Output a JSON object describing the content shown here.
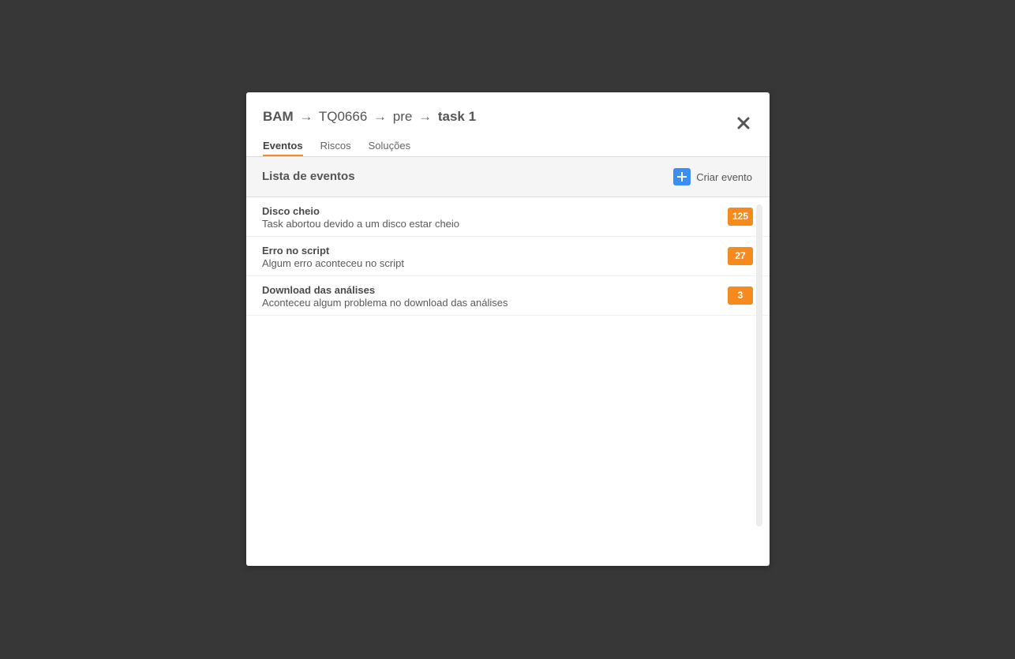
{
  "modal": {
    "breadcrumb": {
      "part1": "BAM",
      "part2": "TQ0666",
      "part3": "pre",
      "part4": "task 1",
      "separator": "→"
    },
    "close_icon": "close-icon",
    "tabs": [
      {
        "label": "Eventos",
        "active": true
      },
      {
        "label": "Riscos",
        "active": false
      },
      {
        "label": "Soluções",
        "active": false
      }
    ]
  },
  "list": {
    "title": "Lista de eventos",
    "create_label": "Criar evento",
    "create_icon": "plus-icon",
    "items": [
      {
        "title": "Disco cheio",
        "description": "Task abortou devido a um disco estar cheio",
        "count": "125"
      },
      {
        "title": "Erro no script",
        "description": "Algum erro aconteceu no script",
        "count": "27"
      },
      {
        "title": "Download das análises",
        "description": "Aconteceu algum problema no download das análises",
        "count": "3"
      }
    ]
  },
  "colors": {
    "background": "#373737",
    "accent": "#f58a1f",
    "create_button": "#3b8ef5"
  }
}
